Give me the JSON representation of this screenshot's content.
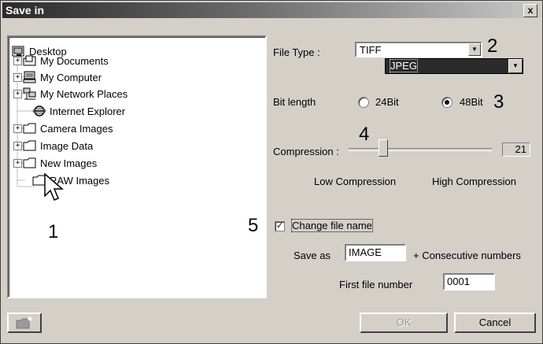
{
  "window": {
    "title": "Save in",
    "close_label": "x"
  },
  "tree": {
    "root": "Desktop",
    "items": [
      {
        "label": "My Documents",
        "icon": "folder-documents-icon",
        "expander": "+"
      },
      {
        "label": "My Computer",
        "icon": "computer-icon",
        "expander": "+"
      },
      {
        "label": "My Network Places",
        "icon": "network-icon",
        "expander": "+"
      },
      {
        "label": "Internet Explorer",
        "icon": "internet-explorer-icon",
        "expander": ""
      },
      {
        "label": "Camera Images",
        "icon": "folder-icon",
        "expander": "+"
      },
      {
        "label": "Image Data",
        "icon": "folder-icon",
        "expander": "+"
      },
      {
        "label": "New Images",
        "icon": "folder-icon",
        "expander": "+"
      },
      {
        "label": "RAW Images",
        "icon": "folder-icon",
        "expander": ""
      }
    ]
  },
  "callouts": {
    "c1": "1",
    "c2": "2",
    "c3": "3",
    "c4": "4",
    "c5": "5"
  },
  "file_type": {
    "label": "File Type :",
    "selected": "TIFF",
    "dropdown_option": "JPEG"
  },
  "bit_length": {
    "label": "Bit length",
    "opt1": "24Bit",
    "opt2": "48Bit",
    "selected": "48Bit"
  },
  "compression": {
    "label": "Compression :",
    "value": "21",
    "low_label": "Low Compression",
    "high_label": "High Compression"
  },
  "change_name": {
    "label": "Change file name",
    "checked": true
  },
  "save_as": {
    "label": "Save as",
    "value": "IMAGE",
    "suffix": "+ Consecutive numbers"
  },
  "first_number": {
    "label": "First file number",
    "value": "0001"
  },
  "buttons": {
    "ok": "OK",
    "cancel": "Cancel"
  }
}
